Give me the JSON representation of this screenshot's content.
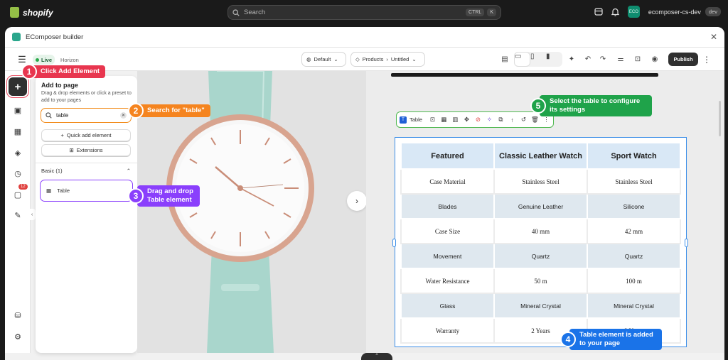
{
  "shopify": {
    "brand": "shopify",
    "search_placeholder": "Search",
    "shortcut_keys": [
      "CTRL",
      "K"
    ],
    "store_avatar": "ECO",
    "store_name": "ecomposer-cs-dev",
    "store_badge": "dev"
  },
  "app": {
    "title": "EComposer builder"
  },
  "toolbar": {
    "live_label": "Live",
    "theme_name": "Horizon",
    "language": "Default",
    "page_type": "Products",
    "page_name": "Untitled",
    "publish_label": "Publish"
  },
  "rail": {
    "notification_count": "12"
  },
  "panel": {
    "title": "Add to page",
    "description": "Drag & drop elements or click a preset to add to your pages",
    "search_value": "table",
    "quick_add_label": "Quick add element",
    "extensions_label": "Extensions",
    "section_label": "Basic (1)",
    "element_label": "Table"
  },
  "element_toolbar": {
    "title": "Table"
  },
  "table": {
    "headers": [
      "Featured",
      "Classic Leather Watch",
      "Sport Watch"
    ],
    "rows": [
      [
        "Case Material",
        "Stainless Steel",
        "Stainless Steel"
      ],
      [
        "Blades",
        "Genuine Leather",
        "Silicone"
      ],
      [
        "Case Size",
        "40 mm",
        "42 mm"
      ],
      [
        "Movement",
        "Quartz",
        "Quartz"
      ],
      [
        "Water Resistance",
        "50 m",
        "100 m"
      ],
      [
        "Glass",
        "Mineral Crystal",
        "Mineral Crystal"
      ],
      [
        "Warranty",
        "2 Years",
        "2 Years"
      ]
    ]
  },
  "callouts": [
    {
      "num": "1",
      "text": "Click Add Element"
    },
    {
      "num": "2",
      "text": "Search for \"table\""
    },
    {
      "num": "3",
      "text": "Drag and drop Table element"
    },
    {
      "num": "4",
      "text": "Table element is added to your page"
    },
    {
      "num": "5",
      "text": "Select the table to configure its settings"
    }
  ],
  "colors": {
    "step1": "#e8364f",
    "step2": "#f5841f",
    "step3": "#8a3ffc",
    "step4": "#1a73e8",
    "step5": "#1fa34a",
    "selection": "#3d8fe8"
  }
}
